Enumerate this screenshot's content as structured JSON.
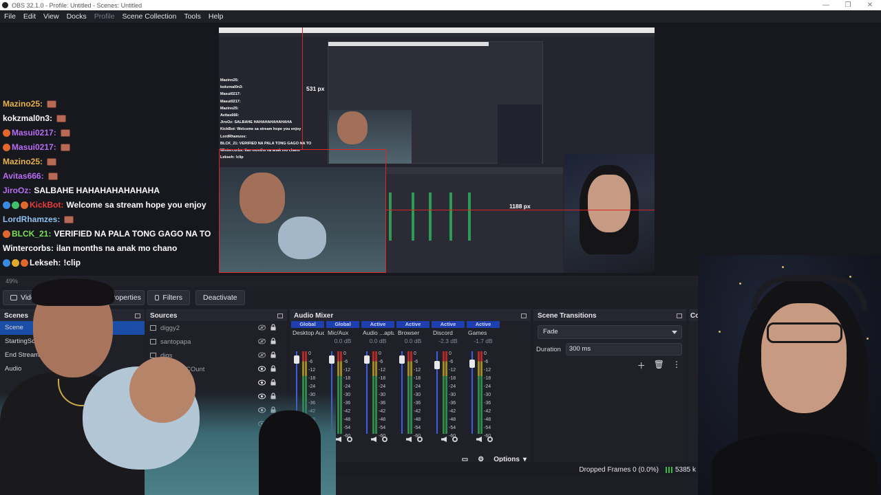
{
  "window": {
    "title": "OBS 32.1.0 - Profile: Untitled - Scenes: Untitled",
    "controls": [
      "—",
      "❐",
      "✕"
    ]
  },
  "menu": [
    "File",
    "Edit",
    "View",
    "Docks",
    "Profile",
    "Scene Collection",
    "Tools",
    "Help"
  ],
  "preview": {
    "measure_top": "531 px",
    "measure_right": "1188 px",
    "mini_chat": [
      "Mazino25:",
      "kokzmal0n3:",
      "Masui0217:",
      "Masui0217:",
      "Mazino25:",
      "Avitas666:",
      "JiroOz: SALBAHE HAHAHAHAHAHAHA",
      "KickBot: Welcome sa stream hope you enjoy",
      "LordRhamzes:",
      "BLCK_21: VERIFIED NA PALA TONG GAGO NA TO",
      "Wintercorbs: ilan months na anak mo chano",
      "Lekseh: !clip"
    ]
  },
  "chat": [
    {
      "user": "Mazino25:",
      "text": "",
      "color": "#e6b24a",
      "emote": true,
      "badges": []
    },
    {
      "user": "kokzmal0n3:",
      "text": "",
      "color": "#ffffff",
      "emote": true,
      "badges": []
    },
    {
      "user": "Masui0217:",
      "text": "",
      "color": "#b66cf0",
      "emote": true,
      "badges": [
        "#e0672d"
      ]
    },
    {
      "user": "Masui0217:",
      "text": "",
      "color": "#b66cf0",
      "emote": true,
      "badges": [
        "#e0672d"
      ]
    },
    {
      "user": "Mazino25:",
      "text": "",
      "color": "#e6b24a",
      "emote": true,
      "badges": []
    },
    {
      "user": "Avitas666:",
      "text": "",
      "color": "#b66cf0",
      "emote": true,
      "badges": []
    },
    {
      "user": "JiroOz:",
      "text": "SALBAHE HAHAHAHAHAHAHA",
      "color": "#b66cf0",
      "emote": false,
      "badges": []
    },
    {
      "user": "KickBot:",
      "text": "Welcome sa stream hope you enjoy",
      "color": "#e83c3c",
      "emote": false,
      "badges": [
        "#3a8be0",
        "#41c26a",
        "#e0672d"
      ]
    },
    {
      "user": "LordRhamzes:",
      "text": "",
      "color": "#8fc1f0",
      "emote": true,
      "badges": []
    },
    {
      "user": "BLCK_21:",
      "text": "VERIFIED NA PALA TONG GAGO NA TO",
      "color": "#7be05a",
      "emote": false,
      "badges": [
        "#e0672d"
      ]
    },
    {
      "user": "Wintercorbs:",
      "text": "ilan months na anak mo chano",
      "color": "#ffffff",
      "emote": false,
      "badges": []
    },
    {
      "user": "Lekseh:",
      "text": "!clip",
      "color": "#ffffff",
      "emote": false,
      "badges": [
        "#3a8be0",
        "#e0a92d",
        "#e0672d"
      ]
    }
  ],
  "status_row": {
    "zoom": "49%"
  },
  "toolbar": {
    "video_label": "Video",
    "properties_label": "Properties",
    "filters_label": "Filters",
    "deactivate_label": "Deactivate"
  },
  "scenes": {
    "title": "Scenes",
    "items": [
      "Scene",
      "StartingSoon",
      "End Stream",
      "Audio"
    ],
    "selected": 0
  },
  "sources": {
    "title": "Sources",
    "items": [
      "diggy2",
      "santopapa",
      "digs",
      "Hospital COunt",
      "",
      "",
      "",
      ""
    ]
  },
  "mixer": {
    "title": "Audio Mixer",
    "channels": [
      {
        "tag": "Global",
        "name": "Desktop Audio",
        "db": "",
        "level": 0.95
      },
      {
        "tag": "Global",
        "name": "Mic/Aux",
        "db": "0.0 dB",
        "level": 0.95
      },
      {
        "tag": "Active",
        "name": "Audio ...apture",
        "db": "0.0 dB",
        "level": 0.95
      },
      {
        "tag": "Active",
        "name": "Browser",
        "db": "0.0 dB",
        "level": 0.95
      },
      {
        "tag": "Active",
        "name": "Discord",
        "db": "-2.3 dB",
        "level": 0.88
      },
      {
        "tag": "Active",
        "name": "Games",
        "db": "-1.7 dB",
        "level": 0.9
      }
    ],
    "scale": [
      "0",
      "-6",
      "-12",
      "-18",
      "-24",
      "-30",
      "-36",
      "-42",
      "-48",
      "-54",
      "-60"
    ],
    "options_label": "Options"
  },
  "transitions": {
    "title": "Scene Transitions",
    "selected": "Fade",
    "duration_label": "Duration",
    "duration_value": "300 ms"
  },
  "controls": {
    "title": "Co"
  },
  "statusbar": {
    "dropped": "Dropped Frames 0 (0.0%)",
    "bitrate": "5385 k"
  },
  "colors": {
    "accent": "#1a4ea6",
    "active_tag": "#1f3fb0",
    "guide_red": "#e02424"
  }
}
